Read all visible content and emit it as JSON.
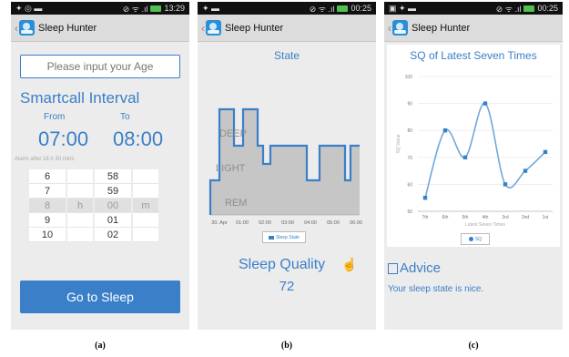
{
  "screen_a": {
    "status_time": "13:29",
    "app_title": "Sleep Hunter",
    "age_placeholder": "Please input your Age",
    "smartcall_title": "Smartcall Interval",
    "from_label": "From",
    "to_label": "To",
    "from_time": "07:00",
    "to_time": "08:00",
    "alarm_note": "Alarm after 18 h 30 mins.",
    "hour_options": [
      "6",
      "7",
      "8",
      "9",
      "10"
    ],
    "hour_unit": "h",
    "minute_options": [
      "58",
      "59",
      "00",
      "01",
      "02"
    ],
    "minute_unit": "m",
    "selected_index": 2,
    "go_button": "Go to Sleep",
    "caption": "(a)"
  },
  "screen_b": {
    "status_time": "00:25",
    "app_title": "Sleep Hunter",
    "chart_title": "State",
    "levels": [
      "DEEP",
      "LIGHT",
      "REM"
    ],
    "x_ticks": [
      "30. Apr",
      "01:00",
      "02:00",
      "03:00",
      "04:00",
      "05:00",
      "06:00"
    ],
    "legend": "Sleep State",
    "quality_label": "Sleep Quality",
    "quality_value": "72",
    "caption": "(b)"
  },
  "screen_c": {
    "status_time": "00:25",
    "app_title": "Sleep Hunter",
    "advice_title": "Advice",
    "advice_text": "Your sleep state is nice.",
    "caption": "(c)"
  },
  "chart_data": [
    {
      "type": "area",
      "title": "State",
      "x": [
        "30. Apr",
        "01:00",
        "02:00",
        "03:00",
        "04:00",
        "05:00",
        "06:00"
      ],
      "y_levels": [
        "REM",
        "LIGHT",
        "DEEP"
      ],
      "legend": [
        "Sleep State"
      ]
    },
    {
      "type": "line",
      "title": "SQ of Latest Seven Times",
      "categories": [
        "7th",
        "6th",
        "5th",
        "4th",
        "3rd",
        "2nd",
        "1st"
      ],
      "series": [
        {
          "name": "SQ",
          "values": [
            55,
            80,
            70,
            90,
            60,
            65,
            72
          ]
        }
      ],
      "xlabel": "Latest Seven Times",
      "ylabel": "SQ Value",
      "ylim": [
        50,
        100
      ],
      "yticks": [
        50,
        60,
        70,
        80,
        90,
        100
      ]
    }
  ]
}
